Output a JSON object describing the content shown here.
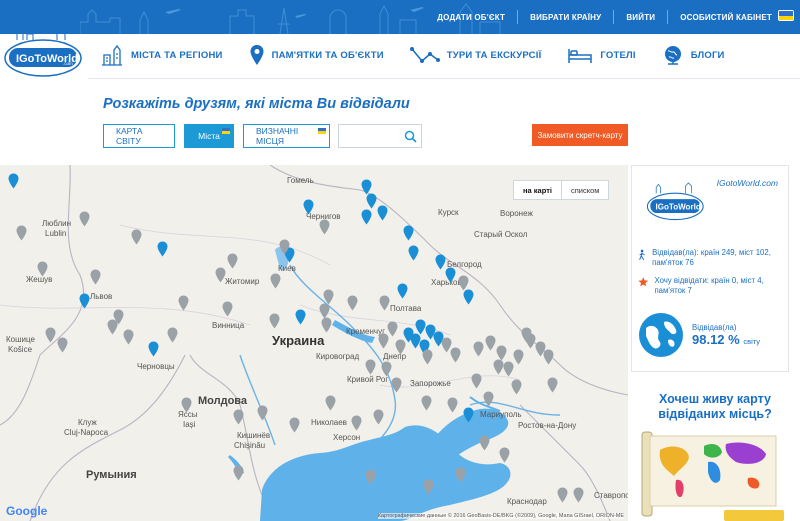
{
  "topnav": {
    "items": [
      "ДОДАТИ ОБ'ЄКТ",
      "ВИБРАТИ КРАЇНУ",
      "ВИЙТИ",
      "ОСОБИСТИЙ КАБІНЕТ"
    ]
  },
  "logo": {
    "text": "IGoToWorld",
    "suffix": ".com"
  },
  "mainnav": {
    "items": [
      {
        "label": "МІСТА ТА РЕГІОНИ",
        "icon": "city-icon"
      },
      {
        "label": "ПАМ'ЯТКИ ТА ОБ'ЄКТИ",
        "icon": "map-pin-icon"
      },
      {
        "label": "ТУРИ ТА ЕКСКУРСІЇ",
        "icon": "route-icon"
      },
      {
        "label": "ГОТЕЛІ",
        "icon": "bed-icon"
      },
      {
        "label": "БЛОГИ",
        "icon": "globe-icon"
      }
    ]
  },
  "headline": "Розкажіть друзям, які міста Ви відвідали",
  "tabs": [
    "КАРТА СВІТУ",
    "Міста",
    "ВИЗНАЧНІ МІСЦЯ"
  ],
  "search": {
    "placeholder": ""
  },
  "order_button": "Замовити скретч-карту",
  "map": {
    "switch_on": "на карті",
    "switch_off": "списком",
    "copyright": "Картографические данные © 2016 GeoBasis-DE/BKG (©2009), Google, Мапа GISrael, ORION-ME",
    "google": "Google",
    "labels": [
      "Гомель",
      "Люблин",
      "Lublin",
      "Жешув",
      "Львов",
      "Кошице",
      "Košice",
      "Чернигов",
      "Курск",
      "Воронеж",
      "Старый Оскол",
      "Белгород",
      "Житомир",
      "Киев",
      "Харьков",
      "Винница",
      "Полтава",
      "Кременчуг",
      "Украина",
      "Черновцы",
      "Кировоград",
      "Днепр",
      "Кривой Рог",
      "Запорожье",
      "Молдова",
      "Кишинёв",
      "Chișinău",
      "Клуж",
      "Cluj-Napoca",
      "Яссы",
      "Iași",
      "Николаев",
      "Херсон",
      "Мариуполь",
      "Ростов-на-Дону",
      "Румыния",
      "Краснодар",
      "Ставрополь",
      "Ставрополь"
    ]
  },
  "sidebar": {
    "site": "IGotoWorld.com",
    "visited": "Відвідав(ла): країн 249, міст 102, пам'яток 76",
    "want": "Хочу відвідати: країн 0, міст 4, пам'яток 7",
    "pct_label": "Відвідав(ла)",
    "pct_value": "98.12 %",
    "pct_suffix": "світу"
  },
  "promo": {
    "question": "Хочеш живу карту відвіданих місць?"
  },
  "colors": {
    "brand": "#1b6fc2",
    "accent": "#f15a24",
    "pin_visited": "#1b8fd6",
    "pin_other": "#9aa2a8"
  }
}
